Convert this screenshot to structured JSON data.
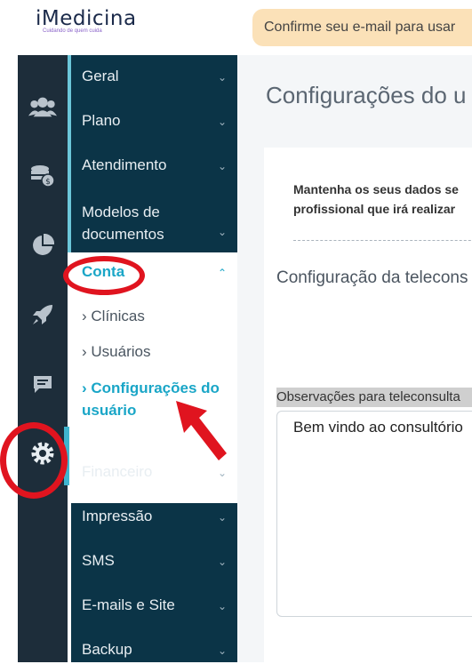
{
  "app": {
    "logo_text": "iMedicina",
    "tagline": "Cuidando de quem cuida"
  },
  "banner": {
    "text": "Confirme seu e-mail para usar"
  },
  "rail": {
    "icons": [
      "users-icon",
      "coins-icon",
      "pie-chart-icon",
      "rocket-icon",
      "chat-icon",
      "gear-icon"
    ]
  },
  "submenu": {
    "geral": "Geral",
    "plano": "Plano",
    "atendimento": "Atendimento",
    "modelos_line1": "Modelos de",
    "modelos_line2": "documentos",
    "conta": "Conta",
    "clinicas": "Clínicas",
    "usuarios": "Usuários",
    "config_line1": "Configurações do",
    "config_line2": "usuário",
    "financeiro": "Financeiro",
    "impressao": "Impressão",
    "sms": "SMS",
    "emails": "E-mails e Site",
    "backup": "Backup"
  },
  "main": {
    "title": "Configurações do u",
    "notice_line1": "Mantenha os seus dados se",
    "notice_line2": "profissional que irá realizar",
    "section_title": "Configuração da telecons",
    "obs_label": "Observações para teleconsulta",
    "obs_value": "Bem vindo ao consultório"
  },
  "colors": {
    "accent": "#1aa6c7",
    "sidebar": "#0b3447",
    "rail": "#1d2d3a",
    "annotation": "#e0141f",
    "banner_bg": "#fbe1b8"
  }
}
